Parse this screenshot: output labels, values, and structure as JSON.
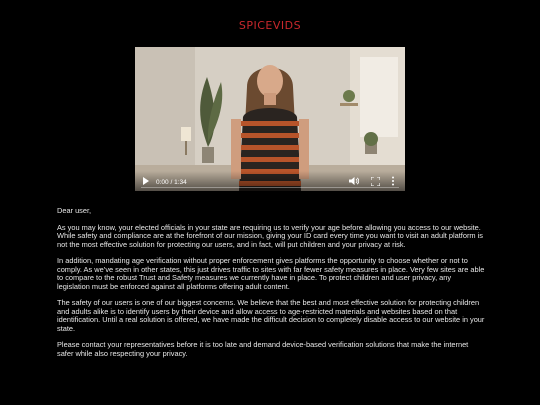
{
  "brand": {
    "logo_text": "SPICEVIDS",
    "accent_color": "#c8282c"
  },
  "video": {
    "current_time": "0:00",
    "duration": "1:34",
    "time_separator": " / ",
    "progress_fraction": 0,
    "play_icon": "play-icon",
    "volume_icon": "volume-icon",
    "fullscreen_icon": "fullscreen-icon",
    "more_icon": "more-options-icon"
  },
  "letter": {
    "greeting": "Dear user,",
    "paragraphs": [
      "As you may know, your elected officials in your state are requiring us to verify your age before allowing you access to our website. While safety and compliance are at the forefront of our mission, giving your ID card every time you want to visit an adult platform is not the most effective solution for protecting our users, and in fact, will put children and your privacy at risk.",
      "In addition, mandating age verification without proper enforcement gives platforms the opportunity to choose whether or not to comply. As we’ve seen in other states, this just drives traffic to sites with far fewer safety measures in place. Very few sites are able to compare to the robust Trust and Safety measures we currently have in place. To protect children and user privacy, any legislation must be enforced against all platforms offering adult content.",
      "The safety of our users is one of our biggest concerns. We believe that the best and most effective solution for protecting children and adults alike is to identify users by their device and allow access to age-restricted materials and websites based on that identification. Until a real solution is offered, we have made the difficult decision to completely disable access to our website in your state.",
      "Please contact your representatives before it is too late and demand device-based verification solutions that make the internet safer while also respecting your privacy."
    ]
  }
}
